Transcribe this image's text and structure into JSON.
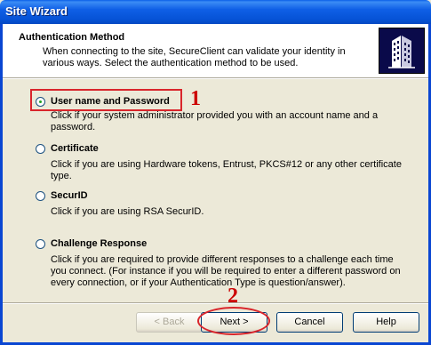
{
  "window": {
    "title": "Site Wizard"
  },
  "header": {
    "title": "Authentication Method",
    "description": "When connecting to the site, SecureClient can validate your identity in various ways. Select the authentication method to be used."
  },
  "options": [
    {
      "label": "User name and Password",
      "description": "Click if your system administrator provided you with an account name and a password.",
      "selected": true
    },
    {
      "label": "Certificate",
      "description": "Click if you are using Hardware tokens, Entrust, PKCS#12 or any other certificate type.",
      "selected": false
    },
    {
      "label": "SecurID",
      "description": "Click if you are using RSA SecurID.",
      "selected": false
    },
    {
      "label": "Challenge Response",
      "description": "Click if you are required to provide different responses to a challenge each time you connect. (For instance if you will be required to enter a different password on every connection, or if your Authentication Type is question/answer).",
      "selected": false
    }
  ],
  "annotations": {
    "step1": "1",
    "step2": "2"
  },
  "buttons": {
    "back": "< Back",
    "next": "Next >",
    "cancel": "Cancel",
    "help": "Help"
  },
  "colors": {
    "titlebar": "#0653d6",
    "highlight": "#d9252b",
    "annotation": "#cc0000",
    "dialog": "#ece9d8"
  }
}
